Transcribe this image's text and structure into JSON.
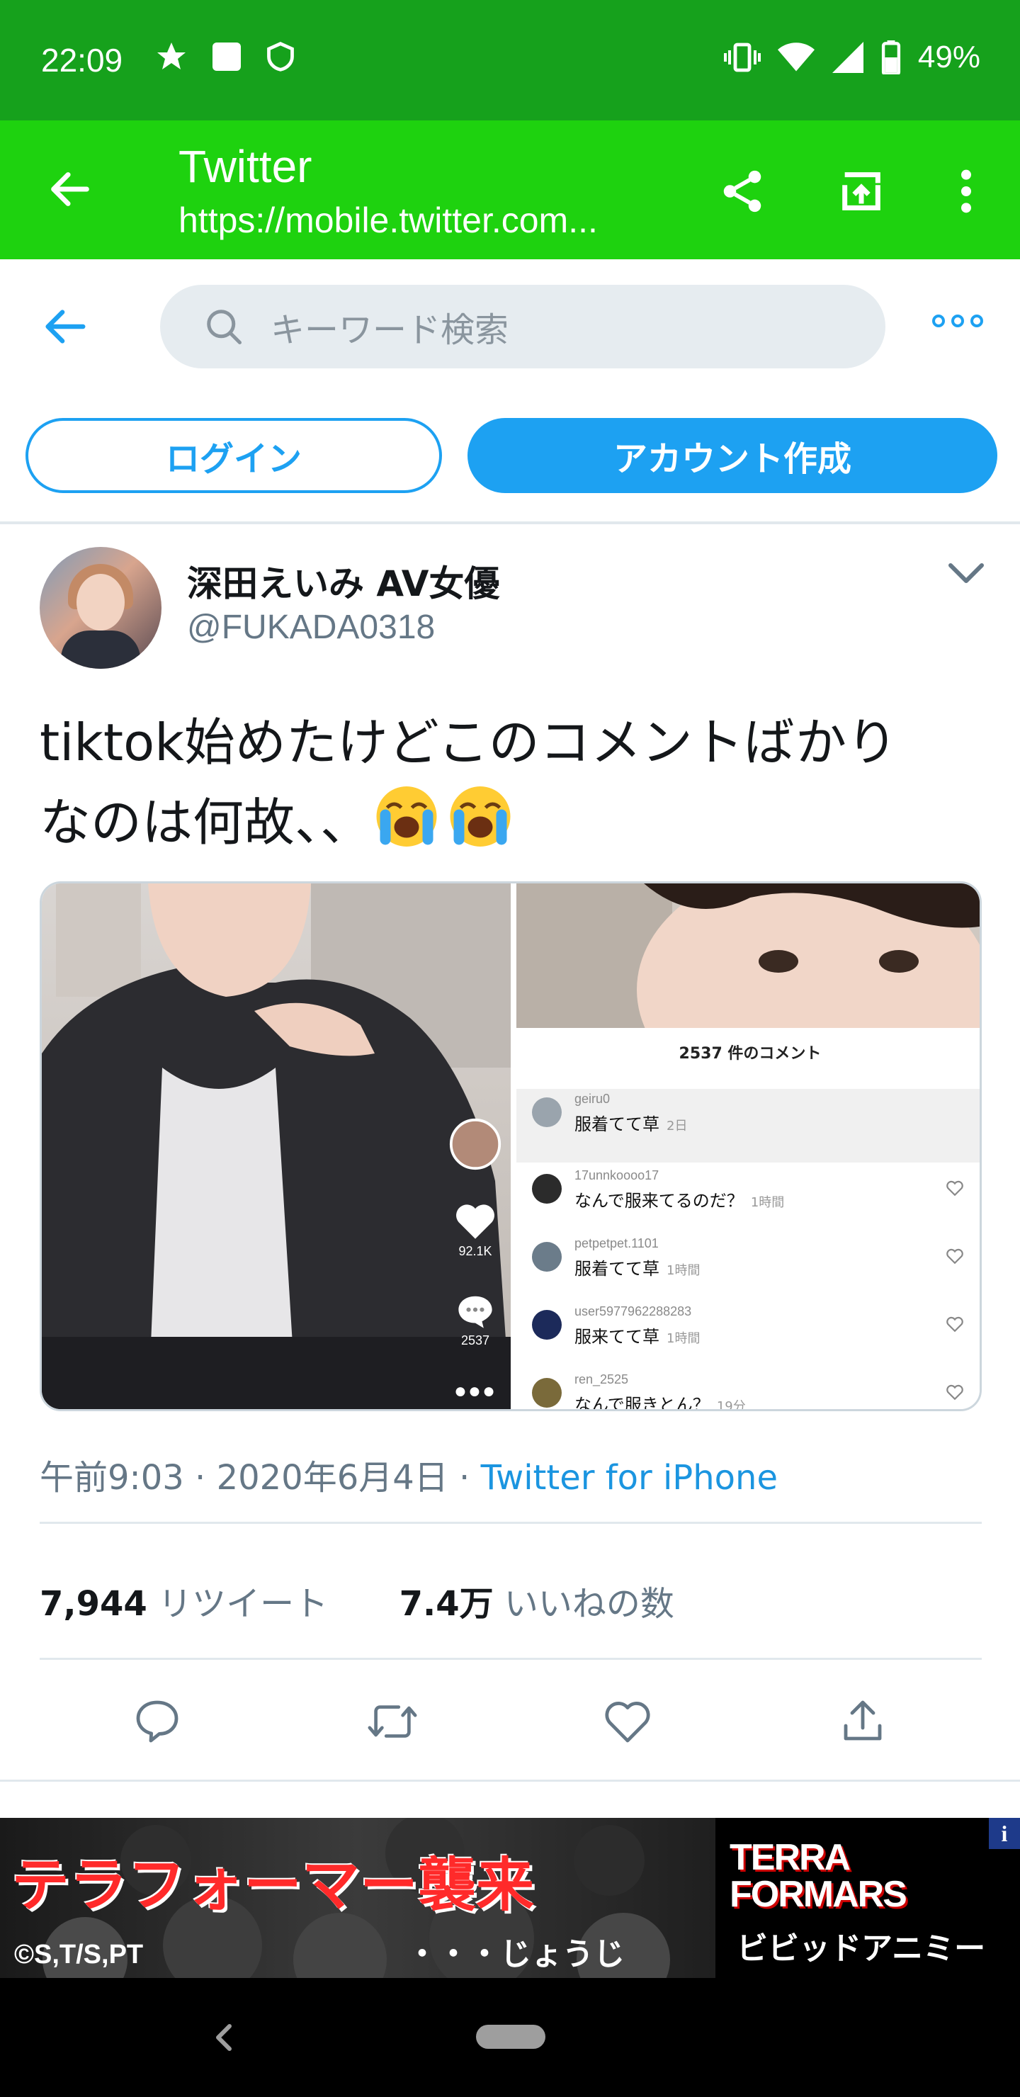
{
  "status_bar": {
    "time": "22:09",
    "battery": "49%",
    "icons": [
      "star-icon",
      "square-notification-icon",
      "shield-icon",
      "vibrate-icon",
      "wifi-icon",
      "signal-icon",
      "battery-icon"
    ]
  },
  "app_bar": {
    "title": "Twitter",
    "url": "https://mobile.twitter.com...",
    "actions": [
      "share-icon",
      "open-external-icon",
      "more-vert-icon"
    ]
  },
  "search": {
    "placeholder": "キーワード検索"
  },
  "auth": {
    "login_label": "ログイン",
    "signup_label": "アカウント作成"
  },
  "tweet": {
    "author_name": "深田えいみ AV女優",
    "author_handle": "@FUKADA0318",
    "text_line1": "tiktok始めたけどこのコメントばかり",
    "text_line2": "なのは何故、、",
    "media": {
      "like_count": "92.1K",
      "comment_icon_count": "2537",
      "comment_header": "2537 件のコメント",
      "comments": [
        {
          "user": "geiru0",
          "text": "服着てて草",
          "time": "2日"
        },
        {
          "user": "17unnkoooo17",
          "text": "なんで服来てるのだ？",
          "time": "1時間"
        },
        {
          "user": "petpetpet.1101",
          "text": "服着てて草",
          "time": "1時間"
        },
        {
          "user": "user5977962288283",
          "text": "服来てて草",
          "time": "1時間"
        },
        {
          "user": "ren_2525",
          "text": "なんで服きとん？",
          "time": "19分"
        }
      ]
    },
    "timestamp": "午前9:03 · 2020年6月4日 · ",
    "source": "Twitter for iPhone",
    "retweet_count": "7,944",
    "retweet_label": " リツイート",
    "like_count": "7.4万",
    "like_label": " いいねの数"
  },
  "ad": {
    "title": "テラフォーマー襲来",
    "subtitle": "・・・じょうじ",
    "copyright": "©S,T/S,PT",
    "logo_line1": "TERRA",
    "logo_line2": "FORMARS",
    "logo_tag": "ビビッドアニミー",
    "info": "i"
  },
  "colors": {
    "status_bar": "#16a11c",
    "app_bar": "#1ed20f",
    "twitter_blue": "#1da1f2",
    "link": "#1b95e0",
    "muted": "#657786"
  }
}
